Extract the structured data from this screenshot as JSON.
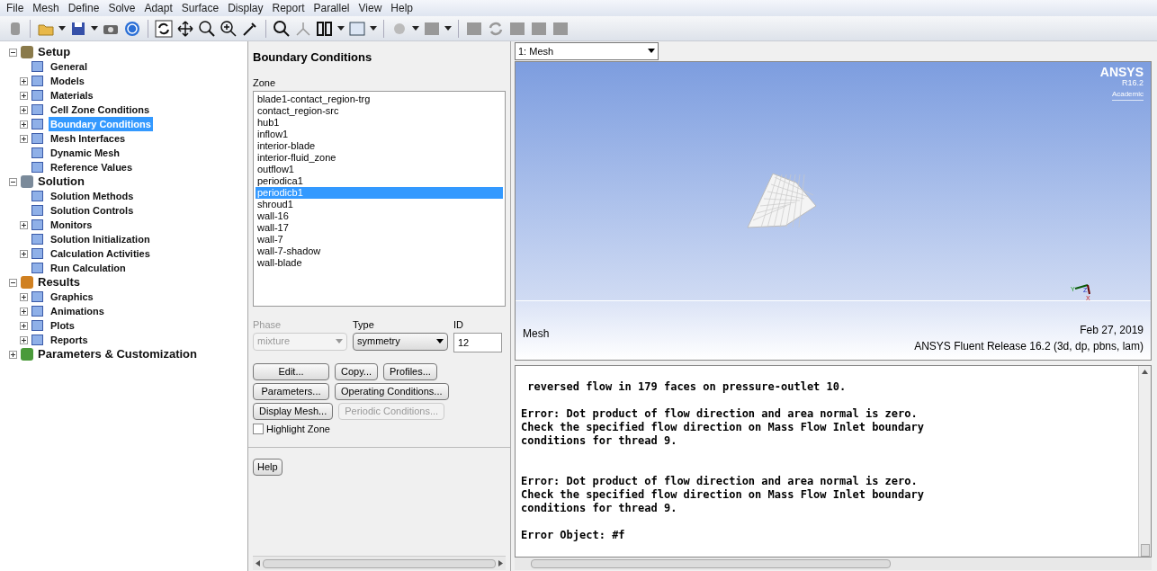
{
  "menu_bar": [
    "File",
    "Mesh",
    "Define",
    "Solve",
    "Adapt",
    "Surface",
    "Display",
    "Report",
    "Parallel",
    "View",
    "Help"
  ],
  "tree": [
    {
      "label": "Setup",
      "expanded": true,
      "children": [
        {
          "label": "General",
          "kind": "leaf",
          "selected": false
        },
        {
          "label": "Models",
          "kind": "branch",
          "selected": false
        },
        {
          "label": "Materials",
          "kind": "branch",
          "selected": false
        },
        {
          "label": "Cell Zone Conditions",
          "kind": "branch",
          "selected": false
        },
        {
          "label": "Boundary Conditions",
          "kind": "branch",
          "selected": true
        },
        {
          "label": "Mesh Interfaces",
          "kind": "branch",
          "selected": false
        },
        {
          "label": "Dynamic Mesh",
          "kind": "leaf",
          "selected": false
        },
        {
          "label": "Reference Values",
          "kind": "leaf",
          "selected": false
        }
      ]
    },
    {
      "label": "Solution",
      "expanded": true,
      "children": [
        {
          "label": "Solution Methods",
          "kind": "leaf",
          "selected": false
        },
        {
          "label": "Solution Controls",
          "kind": "leaf",
          "selected": false
        },
        {
          "label": "Monitors",
          "kind": "branch",
          "selected": false
        },
        {
          "label": "Solution Initialization",
          "kind": "leaf",
          "selected": false
        },
        {
          "label": "Calculation Activities",
          "kind": "branch",
          "selected": false
        },
        {
          "label": "Run Calculation",
          "kind": "leaf",
          "selected": false
        }
      ]
    },
    {
      "label": "Results",
      "expanded": true,
      "children": [
        {
          "label": "Graphics",
          "kind": "branch",
          "selected": false
        },
        {
          "label": "Animations",
          "kind": "branch",
          "selected": false
        },
        {
          "label": "Plots",
          "kind": "branch",
          "selected": false
        },
        {
          "label": "Reports",
          "kind": "branch",
          "selected": false
        }
      ]
    },
    {
      "label": "Parameters & Customization",
      "expanded": false
    }
  ],
  "task_panel": {
    "title": "Boundary Conditions",
    "zone_label": "Zone",
    "zones": [
      {
        "label": "blade1-contact_region-trg",
        "selected": false
      },
      {
        "label": "contact_region-src",
        "selected": false
      },
      {
        "label": "hub1",
        "selected": false
      },
      {
        "label": "inflow1",
        "selected": false
      },
      {
        "label": "interior-blade",
        "selected": false
      },
      {
        "label": "interior-fluid_zone",
        "selected": false
      },
      {
        "label": "outflow1",
        "selected": false
      },
      {
        "label": "periodica1",
        "selected": false
      },
      {
        "label": "periodicb1",
        "selected": true
      },
      {
        "label": "shroud1",
        "selected": false
      },
      {
        "label": "wall-16",
        "selected": false
      },
      {
        "label": "wall-17",
        "selected": false
      },
      {
        "label": "wall-7",
        "selected": false
      },
      {
        "label": "wall-7-shadow",
        "selected": false
      },
      {
        "label": "wall-blade",
        "selected": false
      }
    ],
    "phase": {
      "label": "Phase",
      "value": "mixture",
      "disabled": true
    },
    "type": {
      "label": "Type",
      "value": "symmetry",
      "disabled": false
    },
    "id": {
      "label": "ID",
      "value": "12"
    },
    "buttons": [
      [
        {
          "label": "Edit...",
          "disabled": false
        },
        {
          "label": "Copy...",
          "disabled": false
        },
        {
          "label": "Profiles...",
          "disabled": false
        }
      ],
      [
        {
          "label": "Parameters...",
          "disabled": false
        },
        {
          "label": "Operating Conditions...",
          "disabled": false
        }
      ],
      [
        {
          "label": "Display Mesh...",
          "disabled": false
        },
        {
          "label": "Periodic Conditions...",
          "disabled": true
        }
      ]
    ],
    "highlight_zone": {
      "label": "Highlight Zone",
      "checked": false
    },
    "help_button": "Help"
  },
  "graphics": {
    "window_select": "1: Mesh",
    "logo": "ANSYS",
    "logo_version": "R16.2",
    "logo_edition": "Academic",
    "axis_labels": [
      "Y",
      "Z",
      "X"
    ],
    "caption": "Mesh",
    "date": "Feb 27, 2019",
    "release": "ANSYS Fluent Release 16.2 (3d, dp, pbns, lam)"
  },
  "console": {
    "text": " reversed flow in 179 faces on pressure-outlet 10.\n\nError: Dot product of flow direction and area normal is zero.\nCheck the specified flow direction on Mass Flow Inlet boundary\nconditions for thread 9.\n\n\nError: Dot product of flow direction and area normal is zero.\nCheck the specified flow direction on Mass Flow Inlet boundary\nconditions for thread 9.\n\nError Object: #f"
  }
}
